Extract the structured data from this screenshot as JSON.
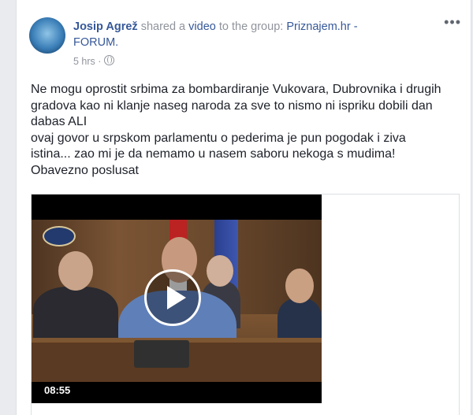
{
  "post": {
    "author": "Josip Agrež",
    "action_shared": "shared a",
    "video_link": "video",
    "to_group": "to the group:",
    "group_name": "Priznajem.hr -",
    "group_name_2": "FORUM.",
    "time": "5 hrs",
    "menu": "•••",
    "text_lines": [
      "Ne mogu oprostit srbima za bombardiranje Vukovara, Dubrovnika i drugih",
      "gradova kao ni klanje naseg naroda za sve to nismo ni ispriku dobili dan",
      "dabas ALI",
      "ovaj govor u srpskom parlamentu o pederima je pun pogodak i ziva",
      "istina... zao mi je da nemamo u nasem saboru nekoga s mudima!",
      "Obavezno poslusat"
    ]
  },
  "video": {
    "duration": "08:55",
    "play_icon": "play-icon"
  },
  "icons": {
    "privacy": "globe-icon",
    "menu": "more-options-icon"
  },
  "colors": {
    "link": "#365899",
    "meta": "#90949c",
    "text": "#1d2129"
  }
}
